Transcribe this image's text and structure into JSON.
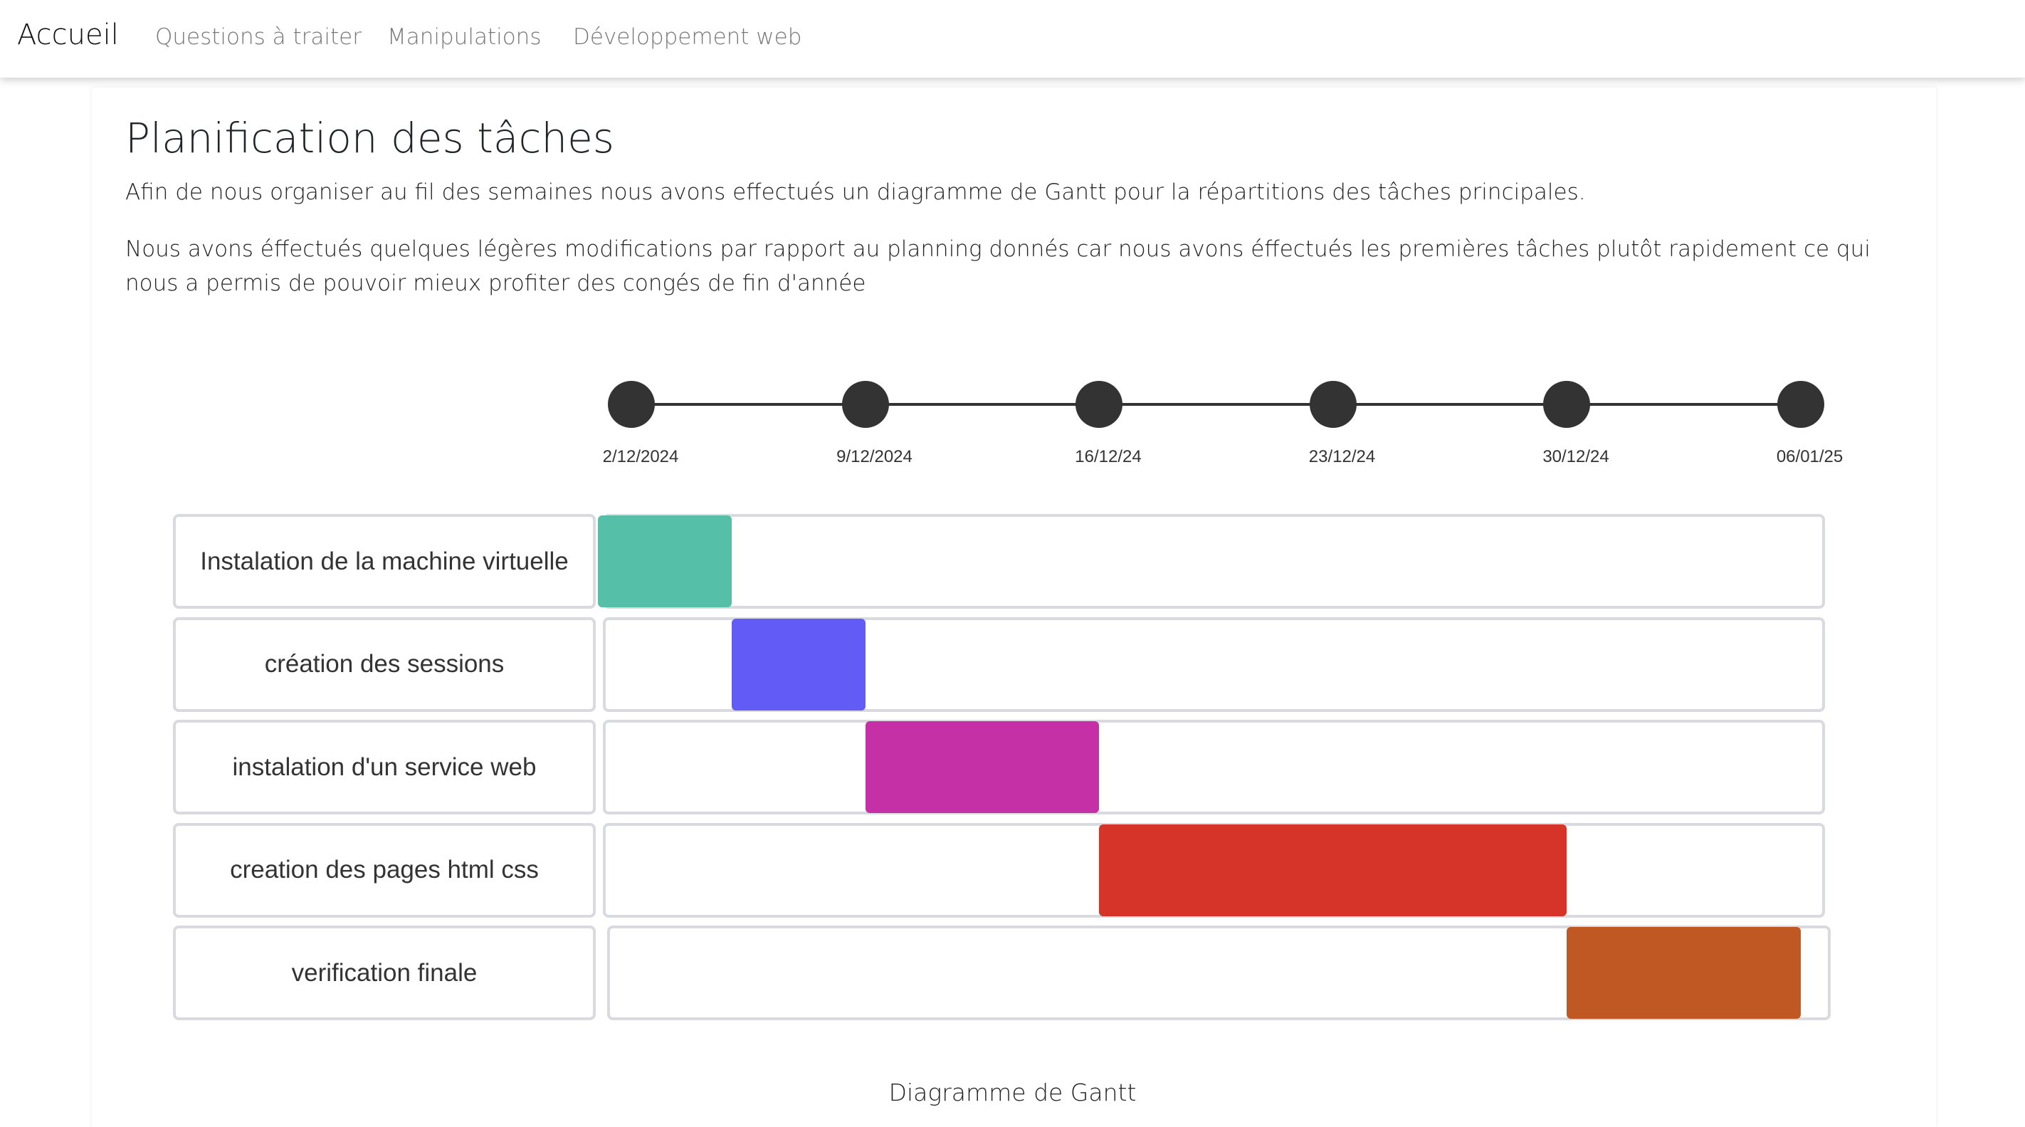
{
  "nav": {
    "brand": "Accueil",
    "links": [
      "Questions à traiter",
      "Manipulations",
      "Développement web"
    ]
  },
  "main": {
    "title": "Planification des tâches",
    "paragraphs": [
      "Afin de nous organiser au fil des semaines nous avons effectués un diagramme de Gantt pour la répartitions des tâches principales.",
      "Nous avons éffectués quelques légères modifications par rapport au planning donnés car nous avons éffectués les premières tâches plutôt rapidement ce qui nous a permis de pouvoir mieux profiter des congés de fin d'année"
    ],
    "caption": "Diagramme de Gantt"
  },
  "chart_data": {
    "type": "gantt",
    "timeline_labels": [
      "2/12/2024",
      "9/12/2024",
      "16/12/24",
      "23/12/24",
      "30/12/24",
      "06/01/25"
    ],
    "timeline_dates": [
      "2024-12-02",
      "2024-12-09",
      "2024-12-16",
      "2024-12-23",
      "2024-12-30",
      "2025-01-06"
    ],
    "tasks": [
      {
        "name": "Instalation de la machine virtuelle",
        "start": "2024-12-01",
        "end": "2024-12-05",
        "color": "#56bfa8"
      },
      {
        "name": "création des sessions",
        "start": "2024-12-05",
        "end": "2024-12-09",
        "color": "#635bf6"
      },
      {
        "name": "instalation d'un service web",
        "start": "2024-12-09",
        "end": "2024-12-16",
        "color": "#c630a6"
      },
      {
        "name": "creation des pages html css",
        "start": "2024-12-16",
        "end": "2024-12-30",
        "color": "#d63428"
      },
      {
        "name": "verification finale",
        "start": "2024-12-30",
        "end": "2025-01-06",
        "color": "#c05823"
      }
    ]
  }
}
